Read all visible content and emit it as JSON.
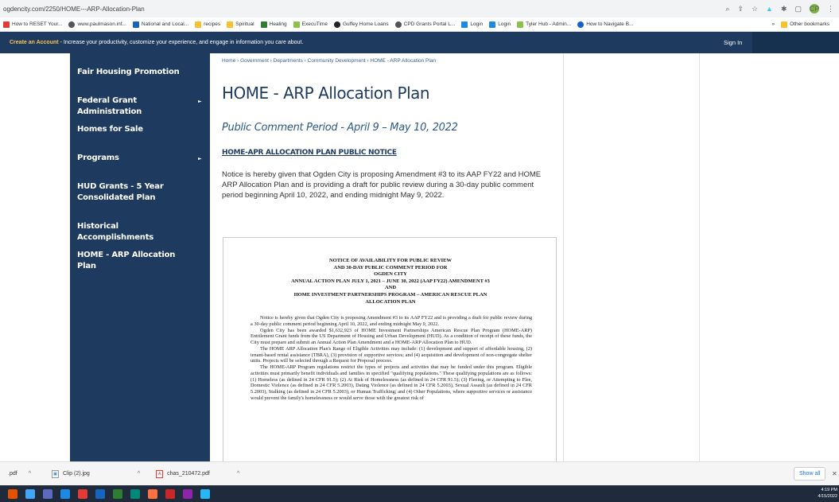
{
  "browser": {
    "url": "ogdencity.com/2250/HOME---ARP-Allocation-Plan",
    "bookmarks": [
      "How to RESET Your...",
      "www.paulmason.inf...",
      "National and Local...",
      "recipes",
      "Spiritual",
      "Healing",
      "ExecuTime",
      "Guffey Home Loans",
      "CPD Grants Portal L...",
      "Login",
      "Login",
      "Tyler Hub - Admin...",
      "How to Navigate B..."
    ],
    "bookmarks_more": "»",
    "other_bookmarks": "Other bookmarks",
    "profile_initials": "CP"
  },
  "site_strip": {
    "create_account": "Create an Account",
    "message": " - Increase your productivity, customize your experience, and engage in information you care about.",
    "sign_in": "Sign In"
  },
  "sidebar": {
    "items": [
      {
        "label": "Fair Housing Promotion",
        "arrow": ""
      },
      {
        "label": "Federal Grant Administration",
        "arrow": "►"
      },
      {
        "label": "Homes for Sale",
        "arrow": ""
      },
      {
        "label": "Programs",
        "arrow": "►"
      },
      {
        "label": "HUD Grants - 5 Year Consolidated Plan",
        "arrow": ""
      },
      {
        "label": "Historical Accomplishments",
        "arrow": ""
      },
      {
        "label": "HOME - ARP Allocation Plan",
        "arrow": ""
      }
    ]
  },
  "content": {
    "breadcrumb": "Home › Government › Departments › Community Development › HOME - ARP Allocation Plan",
    "title": "HOME - ARP Allocation Plan",
    "subtitle": "Public Comment Period - April 9 – May 10, 2022",
    "notice_heading": "HOME-APR ALLOCATION PLAN PUBLIC NOTICE",
    "paragraph": "Notice is hereby given that Ogden City is proposing Amendment #3 to its AAP FY22 and HOME ARP Allocation Plan and is providing a draft for public review during a 30-day public comment period beginning April 10, 2022, and ending midnight May 9, 2022."
  },
  "document": {
    "heading_lines": [
      "NOTICE OF AVAILABILITY FOR PUBLIC REVIEW",
      "AND 30-DAY PUBLIC COMMENT PERIOD FOR",
      "OGDEN CITY",
      "ANNUAL ACTION PLAN JULY 1, 2021 – JUNE 30, 2022 (AAP FY22) AMENDMENT #3",
      "AND",
      "HOME INVESTMENT PARTNERSHIPS PROGRAM – AMERICAN RESCUE PLAN",
      "ALLOCATION PLAN"
    ],
    "paragraphs": [
      "Notice is hereby given that Ogden City is proposing Amendment #3 to its AAP FY22 and is providing a draft for public review during a 30-day public comment period beginning April 10, 2022, and ending midnight May 9, 2022.",
      "Ogden City has been awarded $1,632,923 of HOME Investment Partnerships American Rescue Plan Program (HOME-ARP) Entitlement Grant funds from the US Department of Housing and Urban Development (HUD). As a condition of receipt of these funds, the City must prepare and submit an Annual Action Plan Amendment and a HOME-ARP Allocation Plan to HUD.",
      "The HOME ARP Allocation Plan's Range of Eligible Activities may include: (1) development and support of affordable housing, (2) tenant-based rental assistance (TBRA), (3) provision of supportive services; and (4) acquisition and development of non-congregate shelter units. Projects will be selected through a Request for Proposal process.",
      "The HOME-ARP Program regulations restrict the types of projects and activities that may be funded under this program. Eligible activities must primarily benefit individuals and families in specified \"qualifying populations.\" These qualifying populations are as follows: (1) Homeless (as defined in 24 CFR 91.5); (2) At Risk of Homelessness (as defined in 24 CFR 91.5); (3) Fleeing, or Attempting to Flee, Domestic Violence (as defined in 24 CFR 5.2003), Dating Violence (as defined in 24 CFR 5.2003), Sexual Assault (as defined in 24 CFR 5.2003), Stalking (as defined in 24 CFR 5.2003), or Human Trafficking; and (4) Other Populations, where supportive services or assistance would prevent the family's homelessness or would serve those with the greatest risk of"
    ]
  },
  "downloads": {
    "items": [
      ".pdf",
      "Clip (2).jpg",
      "chas_210472.pdf"
    ],
    "show_all": "Show all",
    "close": "✕"
  },
  "taskbar": {
    "time": "4:19 PM",
    "date": "4/15/2022"
  },
  "colors": {
    "navy": "#1e3a5f",
    "accent": "#f5c451"
  }
}
